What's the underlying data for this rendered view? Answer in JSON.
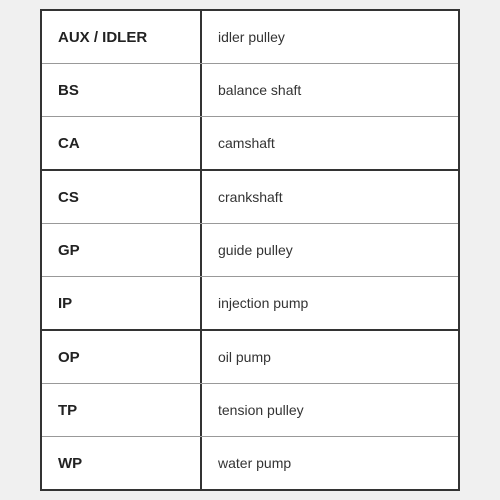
{
  "table": {
    "rows": [
      {
        "code": "AUX / IDLER",
        "description": "idler pulley",
        "thickBottom": false
      },
      {
        "code": "BS",
        "description": "balance shaft",
        "thickBottom": false
      },
      {
        "code": "CA",
        "description": "camshaft",
        "thickBottom": true
      },
      {
        "code": "CS",
        "description": "crankshaft",
        "thickBottom": false
      },
      {
        "code": "GP",
        "description": "guide pulley",
        "thickBottom": false
      },
      {
        "code": "IP",
        "description": "injection pump",
        "thickBottom": true
      },
      {
        "code": "OP",
        "description": "oil pump",
        "thickBottom": false
      },
      {
        "code": "TP",
        "description": "tension pulley",
        "thickBottom": false
      },
      {
        "code": "WP",
        "description": "water pump",
        "thickBottom": false
      }
    ]
  }
}
